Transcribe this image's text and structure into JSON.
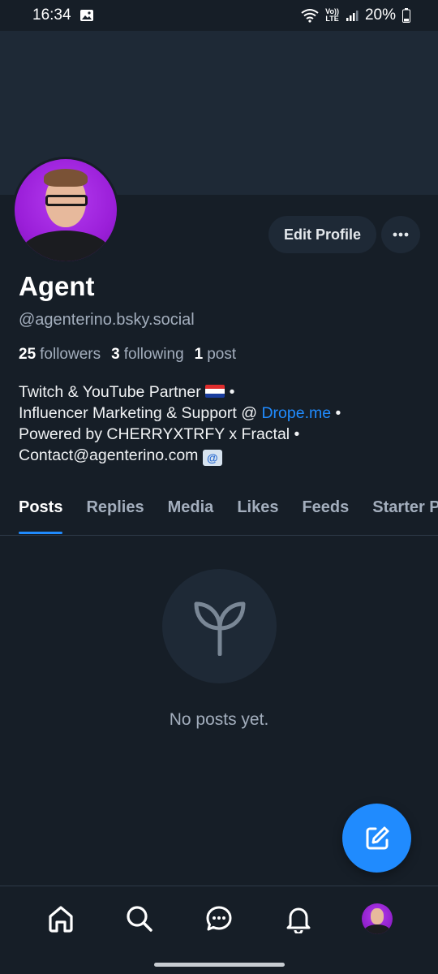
{
  "status_bar": {
    "time": "16:34",
    "network": "LTE",
    "volte": "Vo))",
    "battery": "20%"
  },
  "profile": {
    "display_name": "Agent",
    "handle": "@agenterino.bsky.social",
    "followers_count": "25",
    "followers_label": "followers",
    "following_count": "3",
    "following_label": "following",
    "posts_count": "1",
    "posts_label": "post",
    "bio": {
      "line1": "Twitch & YouTube Partner",
      "line1_end": " •",
      "line2_prefix": "Influencer Marketing & Support @ ",
      "line2_link": "Drope.me",
      "line2_suffix": " •",
      "line3": "Powered by CHERRYXTRFY x Fractal •",
      "line4": "Contact@agenterino.com "
    }
  },
  "actions": {
    "edit_label": "Edit Profile",
    "more_icon": "ellipsis-icon"
  },
  "tabs": [
    {
      "label": "Posts",
      "active": true
    },
    {
      "label": "Replies",
      "active": false
    },
    {
      "label": "Media",
      "active": false
    },
    {
      "label": "Likes",
      "active": false
    },
    {
      "label": "Feeds",
      "active": false
    },
    {
      "label": "Starter Packs",
      "active": false
    }
  ],
  "empty_state": {
    "text": "No posts yet.",
    "icon": "sprout-icon"
  },
  "nav": [
    {
      "icon": "home-icon"
    },
    {
      "icon": "search-icon"
    },
    {
      "icon": "chat-icon"
    },
    {
      "icon": "bell-icon"
    },
    {
      "icon": "profile-avatar"
    }
  ],
  "colors": {
    "background": "#161e27",
    "surface": "#1e2936",
    "accent": "#208bfe",
    "muted": "#a3aebd"
  }
}
